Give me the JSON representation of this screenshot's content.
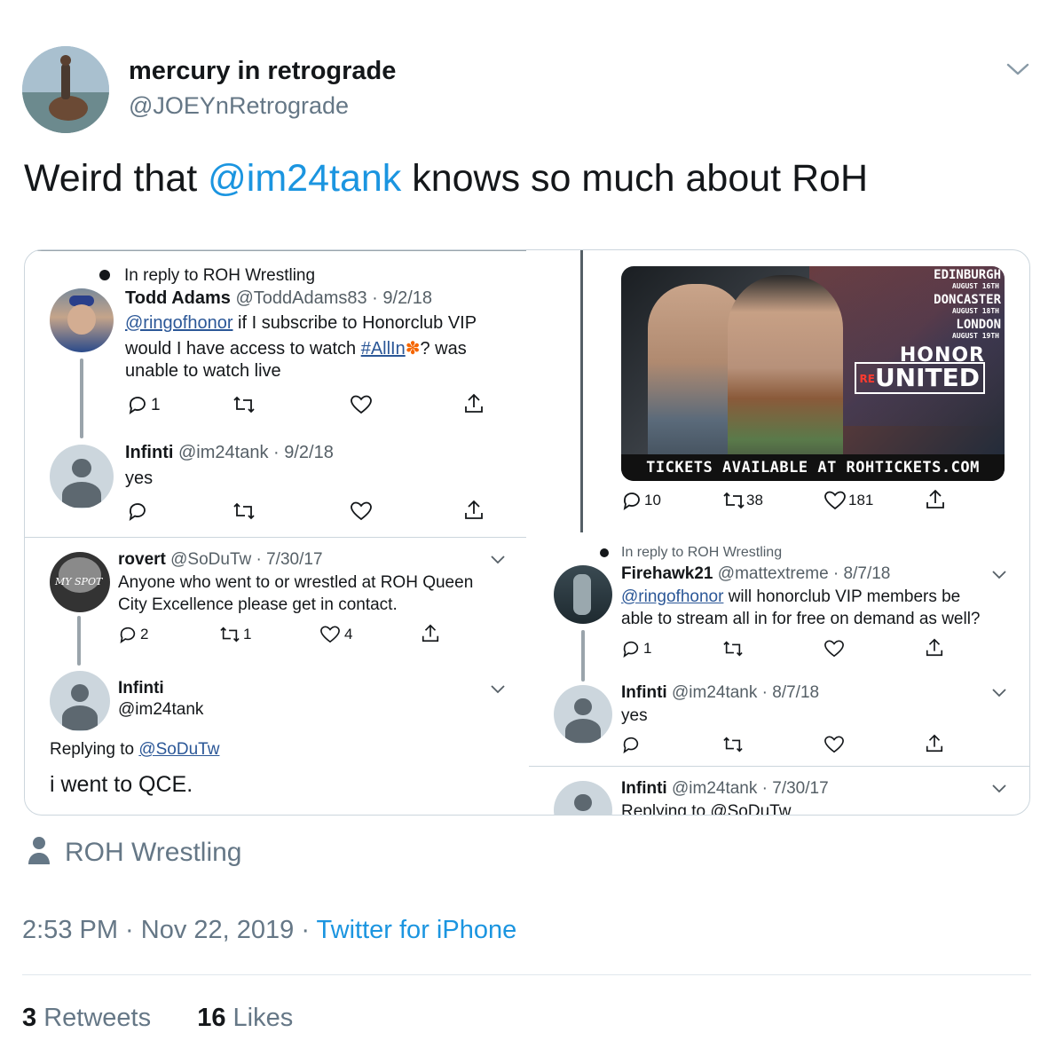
{
  "author": {
    "name": "mercury in retrograde",
    "handle": "@JOEYnRetrograde"
  },
  "tweet": {
    "text_before": "Weird that ",
    "mention": "@im24tank",
    "text_after": " knows so much about RoH"
  },
  "left_panel": {
    "reply_context": "In reply to ROH Wrestling",
    "t1": {
      "name": "Todd Adams",
      "handle_date": "@ToddAdams83 · 9/2/18",
      "line1_mention": "@ringofhonor",
      "line1_rest": " if I subscribe to Honorclub VIP",
      "line2_before": "would I have access to watch ",
      "line2_hashtag": "#AllIn",
      "line2_after": "? was",
      "line3": "unable to watch live",
      "reply_count": "1"
    },
    "t2": {
      "name": "Infinti",
      "handle_date": "@im24tank · 9/2/18",
      "text": "yes"
    },
    "t3": {
      "name": "rovert",
      "handle_date": "@SoDuTw · 7/30/17",
      "line1": "Anyone who went to or wrestled at ROH Queen",
      "line2": "City Excellence please get in contact.",
      "avatar_text": "MY SPOT",
      "replies": "2",
      "retweets": "1",
      "likes": "4"
    },
    "t4": {
      "name": "Infinti",
      "handle": "@im24tank",
      "replying_label": "Replying to ",
      "replying_to": "@SoDuTw",
      "text": "i went to QCE."
    }
  },
  "right_panel": {
    "poster": {
      "city1": "EDINBURGH",
      "date1": "AUGUST 16TH",
      "city2": "DONCASTER",
      "date2": "AUGUST 18TH",
      "city3": "LONDON",
      "date3": "AUGUST 19TH",
      "brand1": "HONOR",
      "brand_re": "RE",
      "brand2": "UNITED",
      "footer": "TICKETS AVAILABLE AT ROHTICKETS.COM"
    },
    "poster_stats": {
      "replies": "10",
      "retweets": "38",
      "likes": "181"
    },
    "reply_context": "In reply to ROH Wrestling",
    "t5": {
      "name": "Firehawk21",
      "handle_date": "@mattextreme · 8/7/18",
      "line1_mention": "@ringofhonor",
      "line1_rest": " will honorclub VIP members be",
      "line2": "able to stream all in for free on demand as well?",
      "replies": "1"
    },
    "t6": {
      "name": "Infinti",
      "handle_date": "@im24tank · 8/7/18",
      "text": "yes"
    },
    "t7": {
      "name": "Infinti",
      "handle_date": "@im24tank · 7/30/17",
      "replying": "Replying to @SoDuTw"
    }
  },
  "context": {
    "icon": "person-icon",
    "text": "ROH Wrestling"
  },
  "meta": {
    "time": "2:53 PM",
    "dot": " · ",
    "date": "Nov 22, 2019",
    "source": "Twitter for iPhone"
  },
  "stats": {
    "retweets_count": "3",
    "retweets_label": "Retweets",
    "likes_count": "16",
    "likes_label": "Likes"
  },
  "colors": {
    "link_blue": "#1b95e0",
    "grey_text": "#657786",
    "border": "#ccd6dd"
  }
}
